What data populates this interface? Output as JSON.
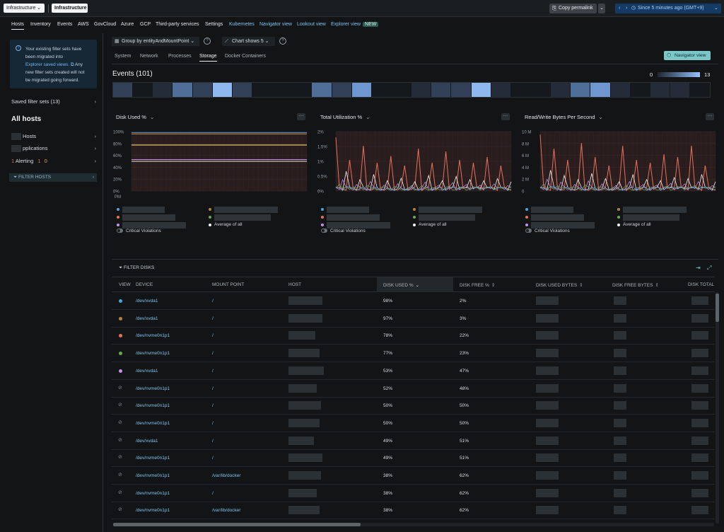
{
  "topbar": {
    "breadcrumb_account": "Infrastructure ⌄",
    "breadcrumb_page": "Infrastructure",
    "copy_permalink": "Copy permalink",
    "time_range": "Since 5 minutes ago (GMT+9)"
  },
  "nav_tabs": [
    {
      "label": "Hosts"
    },
    {
      "label": "Inventory"
    },
    {
      "label": "Events"
    },
    {
      "label": "AWS"
    },
    {
      "label": "GovCloud"
    },
    {
      "label": "Azure"
    },
    {
      "label": "GCP"
    },
    {
      "label": "Third-party services"
    },
    {
      "label": "Settings"
    },
    {
      "label": "Kubernetes"
    },
    {
      "label": "Navigator view"
    },
    {
      "label": "Lookout view"
    },
    {
      "label": "Explorer view"
    }
  ],
  "new_badge": "NEW",
  "sidebar": {
    "info_line1": "Your existing filter sets have",
    "info_line2": "been migrated into",
    "info_link": "Explorer saved views.",
    "info_line3": " Any",
    "info_line4": "new filter sets created will not",
    "info_line5": "be migrated going forward.",
    "saved_filter_sets": "Saved filter sets (13)",
    "all_hosts": "All hosts",
    "hosts_item": "Hosts",
    "apps_item": "pplications",
    "alerting_prefix": "1",
    "alerting_label": "Alerting",
    "alerting_count_1": "1",
    "alerting_count_2": "0",
    "filter_hosts": "FILTER HOSTS"
  },
  "toolbar": {
    "group_by": "Group by  entityAndMountPoint ⌄",
    "chart_shows": "Chart shows  5 ⌄"
  },
  "sub_tabs": [
    {
      "label": "System"
    },
    {
      "label": "Network"
    },
    {
      "label": "Processes"
    },
    {
      "label": "Storage"
    },
    {
      "label": "Docker Containers"
    }
  ],
  "navigator_view": "Navigator view",
  "events": {
    "title": "Events (101)",
    "legend_min": "0",
    "legend_max": "13",
    "heat_levels": [
      2,
      0,
      1,
      3,
      2,
      5,
      2,
      0,
      0,
      0,
      3,
      2,
      4,
      0,
      0,
      1,
      2,
      2,
      5,
      1,
      0,
      0,
      1,
      3,
      4,
      1,
      0,
      1,
      1,
      0
    ]
  },
  "charts": [
    {
      "title": "Disk Used %",
      "y_ticks": [
        "100%",
        "80%",
        "60%",
        "40%",
        "20%",
        "0%"
      ],
      "x_label": "PM",
      "avg_label": "Average of all",
      "critical_label": "Critical Violations"
    },
    {
      "title": "Total Utilization %",
      "y_ticks": [
        "2%",
        "1.5%",
        "1%",
        "0.5%",
        "0%"
      ],
      "avg_label": "Average of all",
      "critical_label": "Critical Violations"
    },
    {
      "title": "Read/Write Bytes Per Second",
      "y_ticks": [
        "10 M",
        "8 M",
        "6 M",
        "4 M",
        "2 M",
        "0"
      ],
      "avg_label": "Average of all",
      "critical_label": "Critical Violations"
    }
  ],
  "colors": {
    "accent_teal": "#7cc8c8",
    "link_blue": "#7cc4f2",
    "series": [
      "#4aa3df",
      "#b5813e",
      "#e6705a",
      "#6aa84f",
      "#c990e6"
    ]
  },
  "table": {
    "filter_label": "FILTER DISKS",
    "headers": [
      "VIEW",
      "DEVICE",
      "MOUNT POINT",
      "HOST",
      "DISK USED %",
      "DISK FREE %",
      "DISK USED BYTES",
      "DISK FREE BYTES",
      "DISK TOTAL"
    ],
    "rows": [
      {
        "device": "/dev/xvda1",
        "mount": "/",
        "used": "98%",
        "free": "2%"
      },
      {
        "device": "/dev/xvda1",
        "mount": "/",
        "used": "97%",
        "free": "3%"
      },
      {
        "device": "/dev/nvme0n1p1",
        "mount": "/",
        "used": "78%",
        "free": "22%"
      },
      {
        "device": "/dev/nvme0n1p1",
        "mount": "/",
        "used": "77%",
        "free": "23%"
      },
      {
        "device": "/dev/xvda1",
        "mount": "/",
        "used": "53%",
        "free": "47%"
      },
      {
        "device": "/dev/nvme0n1p1",
        "mount": "/",
        "used": "52%",
        "free": "48%"
      },
      {
        "device": "/dev/nvme0n1p1",
        "mount": "/",
        "used": "50%",
        "free": "50%"
      },
      {
        "device": "/dev/nvme0n1p1",
        "mount": "/",
        "used": "50%",
        "free": "50%"
      },
      {
        "device": "/dev/xvda1",
        "mount": "/",
        "used": "49%",
        "free": "51%"
      },
      {
        "device": "/dev/nvme0n1p1",
        "mount": "/",
        "used": "49%",
        "free": "51%"
      },
      {
        "device": "/dev/nvme0n1p1",
        "mount": "/var/lib/docker",
        "used": "38%",
        "free": "62%"
      },
      {
        "device": "/dev/nvme0n1p1",
        "mount": "/",
        "used": "38%",
        "free": "62%"
      },
      {
        "device": "/dev/nvme0n1p1",
        "mount": "/var/lib/docker",
        "used": "38%",
        "free": "62%"
      }
    ]
  }
}
